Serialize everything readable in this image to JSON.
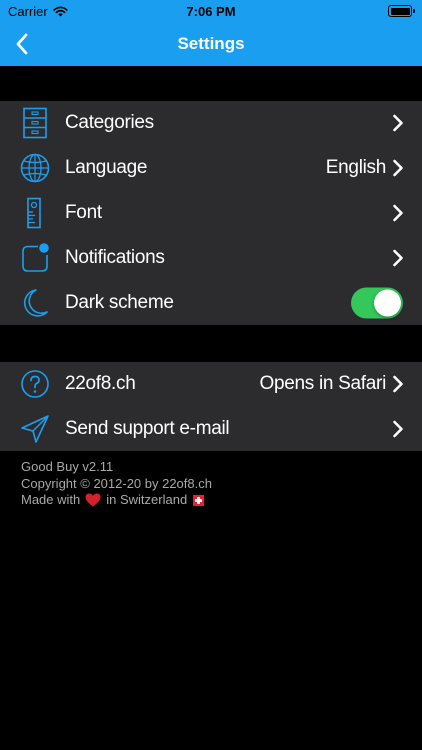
{
  "status_bar": {
    "carrier": "Carrier",
    "time": "7:06 PM"
  },
  "nav": {
    "title": "Settings",
    "back_icon": "chevron-left-icon"
  },
  "colors": {
    "accent": "#1a9ff0",
    "background": "#000000",
    "group_background": "#2c2c2e",
    "toggle_on": "#34c759",
    "footer_text": "#a8a8a8"
  },
  "settings_group": {
    "items": [
      {
        "label": "Categories",
        "value": "",
        "icon": "cabinet-icon"
      },
      {
        "label": "Language",
        "value": "English",
        "icon": "globe-icon"
      },
      {
        "label": "Font",
        "value": "",
        "icon": "ruler-icon"
      },
      {
        "label": "Notifications",
        "value": "",
        "icon": "notification-icon"
      },
      {
        "label": "Dark scheme",
        "icon": "moon-icon",
        "toggle_on": true
      }
    ]
  },
  "support_group": {
    "items": [
      {
        "label": "22of8.ch",
        "value": "Opens in Safari",
        "icon": "question-icon"
      },
      {
        "label": "Send support e-mail",
        "value": "",
        "icon": "paper-plane-icon"
      }
    ]
  },
  "footer": {
    "app_version": "Good Buy v2.11",
    "copyright": "Copyright © 2012-20 by 22of8.ch",
    "made_with_prefix": "Made with",
    "made_with_suffix": "in Switzerland",
    "heart_icon": "heart-icon",
    "flag_icon": "swiss-flag-icon"
  }
}
